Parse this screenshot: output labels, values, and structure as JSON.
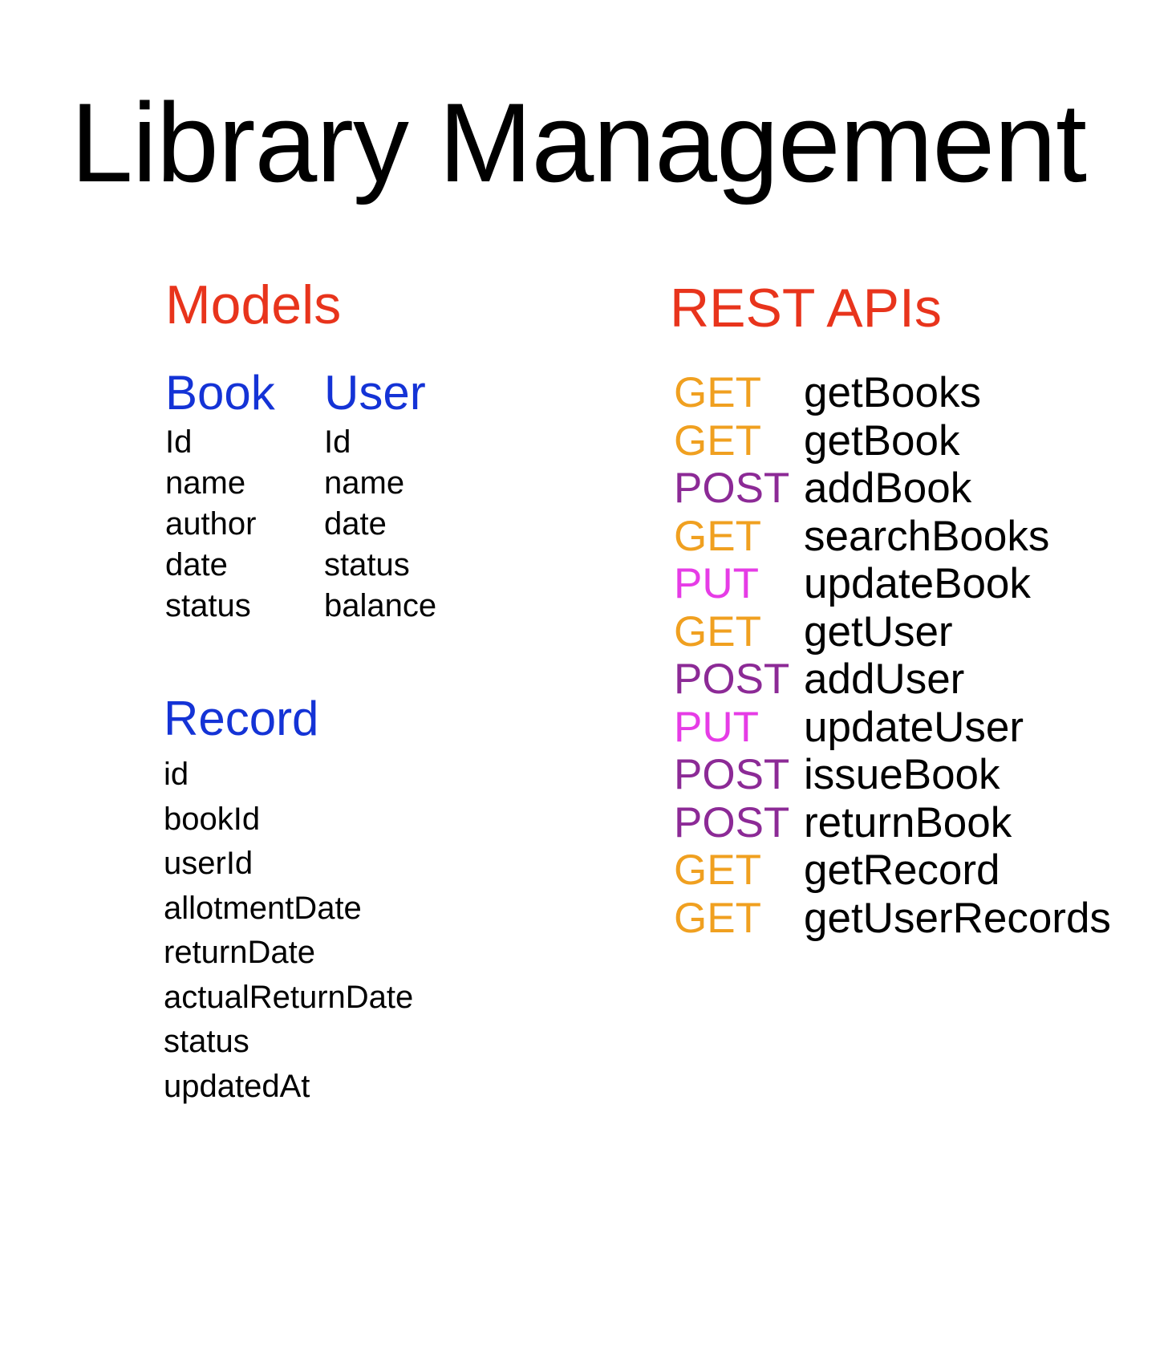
{
  "title": "Library Management",
  "colors": {
    "section": "#e8341c",
    "model": "#1433d6",
    "GET": "#f0a020",
    "POST": "#8c2a96",
    "PUT": "#e63ce6"
  },
  "models": {
    "heading": "Models",
    "book": {
      "name": "Book",
      "fields": [
        "Id",
        "name",
        "author",
        "date",
        "status"
      ]
    },
    "user": {
      "name": "User",
      "fields": [
        "Id",
        "name",
        "date",
        "status",
        "balance"
      ]
    },
    "record": {
      "name": "Record",
      "fields": [
        "id",
        "bookId",
        "userId",
        "allotmentDate",
        "returnDate",
        "actualReturnDate",
        "status",
        "updatedAt"
      ]
    }
  },
  "apis": {
    "heading": "REST APIs",
    "endpoints": [
      {
        "method": "GET",
        "name": "getBooks"
      },
      {
        "method": "GET",
        "name": "getBook"
      },
      {
        "method": "POST",
        "name": "addBook"
      },
      {
        "method": "GET",
        "name": "searchBooks"
      },
      {
        "method": "PUT",
        "name": "updateBook"
      },
      {
        "method": "GET",
        "name": "getUser"
      },
      {
        "method": "POST",
        "name": "addUser"
      },
      {
        "method": "PUT",
        "name": "updateUser"
      },
      {
        "method": "POST",
        "name": "issueBook"
      },
      {
        "method": "POST",
        "name": "returnBook"
      },
      {
        "method": "GET",
        "name": "getRecord"
      },
      {
        "method": "GET",
        "name": "getUserRecords"
      }
    ]
  }
}
